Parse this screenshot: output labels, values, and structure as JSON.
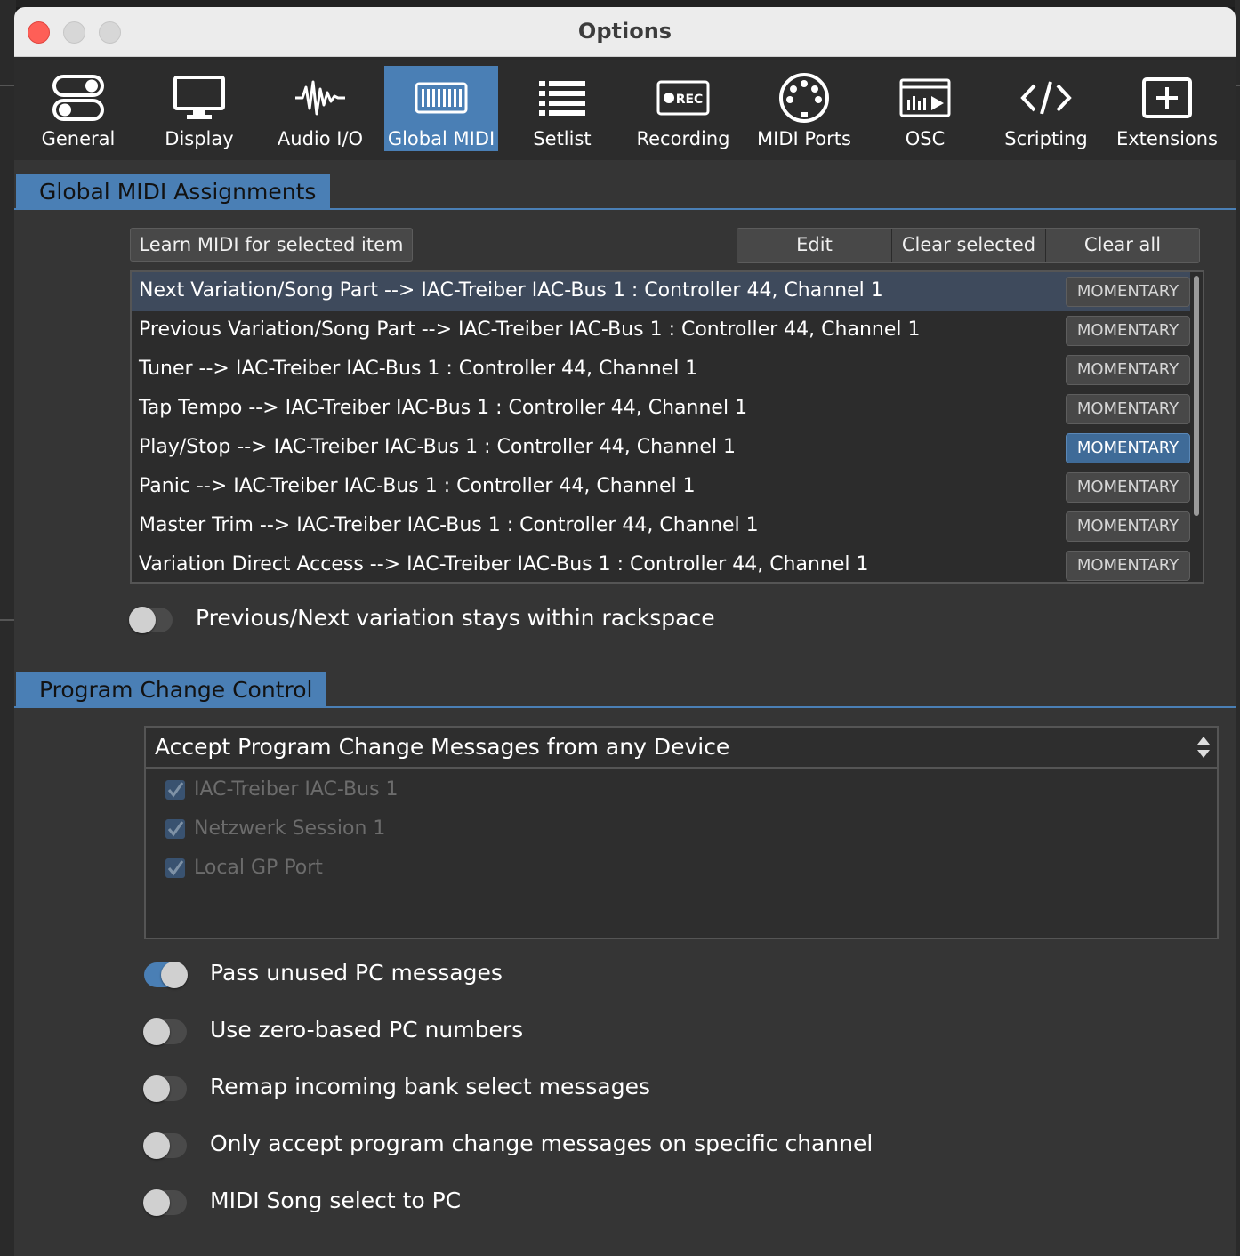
{
  "window": {
    "title": "Options"
  },
  "toolbar": {
    "items": [
      {
        "label": "General",
        "icon": "toggles-icon",
        "active": false
      },
      {
        "label": "Display",
        "icon": "monitor-icon",
        "active": false
      },
      {
        "label": "Audio I/O",
        "icon": "waveform-icon",
        "active": false
      },
      {
        "label": "Global MIDI",
        "icon": "piano-keys-icon",
        "active": true
      },
      {
        "label": "Setlist",
        "icon": "list-icon",
        "active": false
      },
      {
        "label": "Recording",
        "icon": "rec-icon",
        "active": false
      },
      {
        "label": "MIDI Ports",
        "icon": "midi-din-icon",
        "active": false
      },
      {
        "label": "OSC",
        "icon": "osc-icon",
        "active": false
      },
      {
        "label": "Scripting",
        "icon": "code-icon",
        "active": false
      },
      {
        "label": "Extensions",
        "icon": "plus-box-icon",
        "active": false
      }
    ],
    "rec_badge": "REC"
  },
  "global_midi": {
    "section_title": "Global MIDI Assignments",
    "learn_button": "Learn MIDI for selected item",
    "edit_button": "Edit",
    "clear_selected_button": "Clear selected",
    "clear_all_button": "Clear all",
    "assignments": [
      {
        "text": "Next Variation/Song Part --> IAC-Treiber IAC-Bus 1 : Controller 44, Channel 1",
        "mode": "MOMENTARY",
        "selected": true,
        "mode_active": false
      },
      {
        "text": "Previous Variation/Song Part --> IAC-Treiber IAC-Bus 1 : Controller 44, Channel 1",
        "mode": "MOMENTARY",
        "selected": false,
        "mode_active": false
      },
      {
        "text": "Tuner --> IAC-Treiber IAC-Bus 1 : Controller 44, Channel 1",
        "mode": "MOMENTARY",
        "selected": false,
        "mode_active": false
      },
      {
        "text": "Tap Tempo --> IAC-Treiber IAC-Bus 1 : Controller 44, Channel 1",
        "mode": "MOMENTARY",
        "selected": false,
        "mode_active": false
      },
      {
        "text": "Play/Stop --> IAC-Treiber IAC-Bus 1 : Controller 44, Channel 1",
        "mode": "MOMENTARY",
        "selected": false,
        "mode_active": true
      },
      {
        "text": "Panic --> IAC-Treiber IAC-Bus 1 : Controller 44, Channel 1",
        "mode": "MOMENTARY",
        "selected": false,
        "mode_active": false
      },
      {
        "text": "Master Trim --> IAC-Treiber IAC-Bus 1 : Controller 44, Channel 1",
        "mode": "MOMENTARY",
        "selected": false,
        "mode_active": false
      },
      {
        "text": "Variation Direct Access --> IAC-Treiber IAC-Bus 1 : Controller 44, Channel 1",
        "mode": "MOMENTARY",
        "selected": false,
        "mode_active": false
      }
    ],
    "stay_in_rackspace": {
      "label": "Previous/Next variation stays within rackspace",
      "on": false
    }
  },
  "program_change": {
    "section_title": "Program Change Control",
    "select_value": "Accept Program Change Messages from any Device",
    "devices": [
      {
        "label": "IAC-Treiber IAC-Bus 1",
        "checked": true
      },
      {
        "label": "Netzwerk Session 1",
        "checked": true
      },
      {
        "label": "Local GP Port",
        "checked": true
      }
    ],
    "options": [
      {
        "label": "Pass unused PC messages",
        "on": true
      },
      {
        "label": "Use zero-based PC numbers",
        "on": false
      },
      {
        "label": "Remap incoming bank select messages",
        "on": false
      },
      {
        "label": "Only accept program change messages on specific channel",
        "on": false
      },
      {
        "label": "MIDI Song select to PC",
        "on": false
      }
    ]
  },
  "colors": {
    "accent": "#4a7fb5",
    "background": "#353535",
    "toolbar": "#2c2c2c",
    "close_button": "#fe5f57"
  }
}
